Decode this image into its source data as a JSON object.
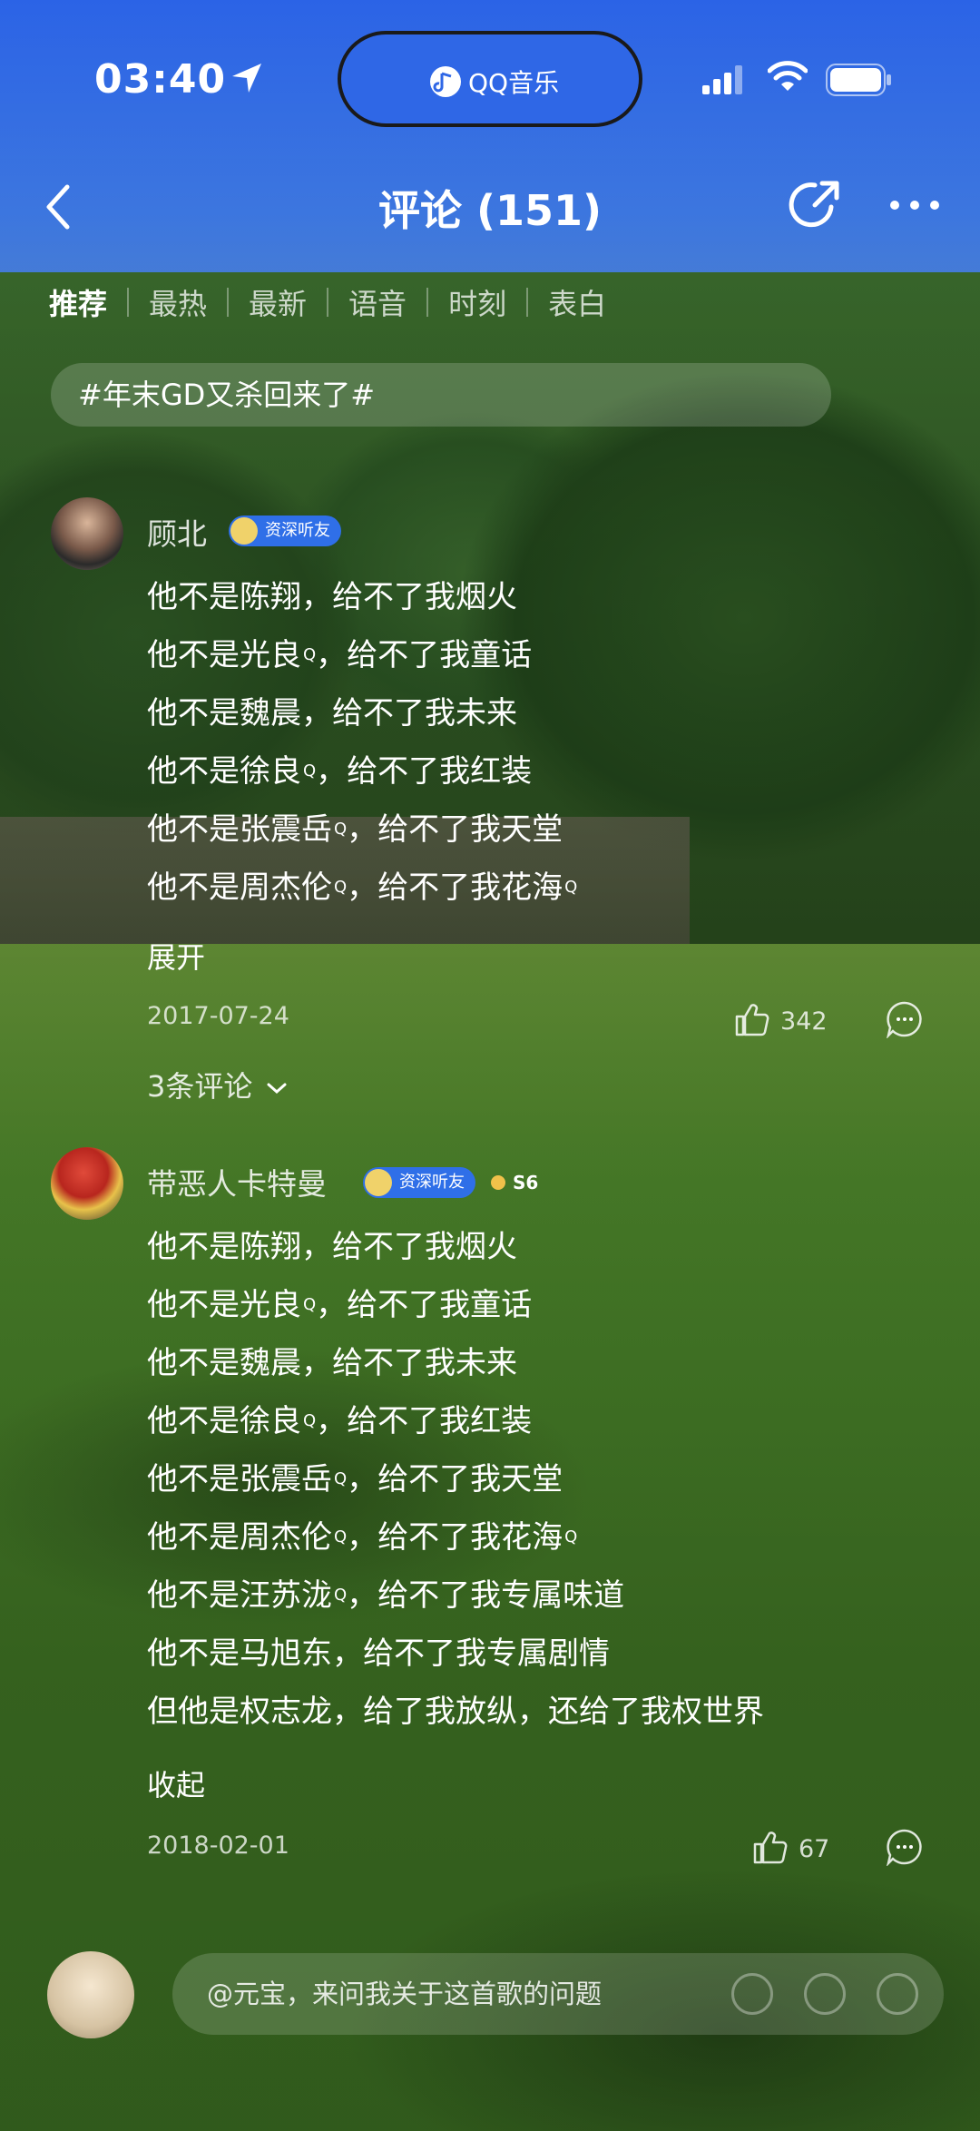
{
  "status_bar": {
    "time": "03:40",
    "island_app": "QQ音乐"
  },
  "header": {
    "title": "评论 (151)"
  },
  "tabs": [
    {
      "label": "推荐",
      "active": true
    },
    {
      "label": "最热",
      "active": false
    },
    {
      "label": "最新",
      "active": false
    },
    {
      "label": "语音",
      "active": false
    },
    {
      "label": "时刻",
      "active": false
    },
    {
      "label": "表白",
      "active": false
    }
  ],
  "topic": "#年末GD又杀回来了#",
  "comments": [
    {
      "username": "顾北",
      "badge": "资深听友",
      "lines": [
        {
          "text": "他不是陈翔，给不了我烟火"
        },
        {
          "pre": "他不是光良",
          "mark": "Q",
          "post": "，给不了我童话"
        },
        {
          "text": "他不是魏晨，给不了我未来"
        },
        {
          "pre": "他不是徐良",
          "mark": "Q",
          "post": "，给不了我红装"
        },
        {
          "pre": "他不是张震岳",
          "mark": "Q",
          "post": "，给不了我天堂"
        },
        {
          "pre": "他不是周杰伦",
          "mark": "Q",
          "post": "，给不了我花海",
          "mark2": "Q"
        }
      ],
      "toggle": "展开",
      "date": "2017-07-24",
      "likes": "342",
      "replies": "3条评论"
    },
    {
      "username": "带恶人卡特曼",
      "badge": "资深听友",
      "level": "S6",
      "lines": [
        {
          "text": "他不是陈翔，给不了我烟火"
        },
        {
          "pre": "他不是光良",
          "mark": "Q",
          "post": "，给不了我童话"
        },
        {
          "text": "他不是魏晨，给不了我未来"
        },
        {
          "pre": "他不是徐良",
          "mark": "Q",
          "post": "，给不了我红装"
        },
        {
          "pre": "他不是张震岳",
          "mark": "Q",
          "post": "，给不了我天堂"
        },
        {
          "pre": "他不是周杰伦",
          "mark": "Q",
          "post": "，给不了我花海",
          "mark2": "Q"
        },
        {
          "pre": "他不是汪苏泷",
          "mark": "Q",
          "post": "，给不了我专属味道"
        },
        {
          "text": "他不是马旭东，给不了我专属剧情"
        },
        {
          "text": "但他是权志龙，给了我放纵，还给了我权世界"
        }
      ],
      "toggle": "收起",
      "date": "2018-02-01",
      "likes": "67"
    }
  ],
  "input": {
    "placeholder": "@元宝，来问我关于这首歌的问题"
  },
  "colors": {
    "sky": "#2b63e6",
    "badge": "#2f6fe8"
  }
}
